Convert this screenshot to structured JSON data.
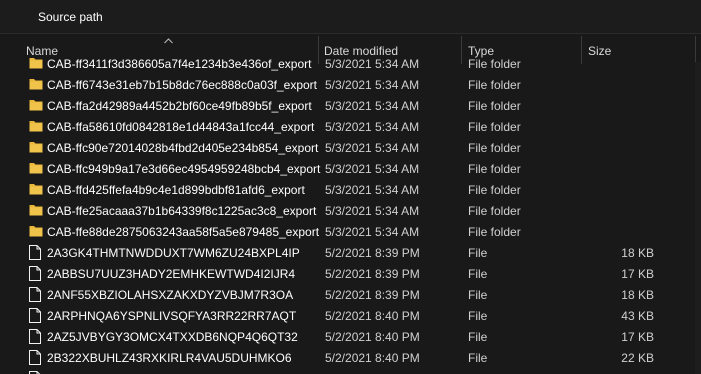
{
  "window": {
    "title": "Source path"
  },
  "columns": [
    {
      "key": "name",
      "label": "Name"
    },
    {
      "key": "date",
      "label": "Date modified"
    },
    {
      "key": "type",
      "label": "Type"
    },
    {
      "key": "size",
      "label": "Size"
    }
  ],
  "colors": {
    "folder": "#e8b73b",
    "file_icon": "#f2f2f2",
    "background": "#191919"
  },
  "rows": [
    {
      "name": "CAB-ff3411f3d386605a7f4e1234b3e436of_export",
      "date": "5/3/2021 5:34 AM",
      "type": "File folder",
      "size": "",
      "icon": "folder-icon"
    },
    {
      "name": "CAB-ff6743e31eb7b15b8dc76ec888c0a03f_export",
      "date": "5/3/2021 5:34 AM",
      "type": "File folder",
      "size": "",
      "icon": "folder-icon"
    },
    {
      "name": "CAB-ffa2d42989a4452b2bf60ce49fb89b5f_export",
      "date": "5/3/2021 5:34 AM",
      "type": "File folder",
      "size": "",
      "icon": "folder-icon"
    },
    {
      "name": "CAB-ffa58610fd0842818e1d44843a1fcc44_export",
      "date": "5/3/2021 5:34 AM",
      "type": "File folder",
      "size": "",
      "icon": "folder-icon"
    },
    {
      "name": "CAB-ffc90e72014028b4fbd2d405e234b854_export",
      "date": "5/3/2021 5:34 AM",
      "type": "File folder",
      "size": "",
      "icon": "folder-icon"
    },
    {
      "name": "CAB-ffc949b9a17e3d66ec4954959248bcb4_export",
      "date": "5/3/2021 5:34 AM",
      "type": "File folder",
      "size": "",
      "icon": "folder-icon"
    },
    {
      "name": "CAB-ffd425ffefa4b9c4e1d899bdbf81afd6_export",
      "date": "5/3/2021 5:34 AM",
      "type": "File folder",
      "size": "",
      "icon": "folder-icon"
    },
    {
      "name": "CAB-ffe25acaaa37b1b64339f8c1225ac3c8_export",
      "date": "5/3/2021 5:34 AM",
      "type": "File folder",
      "size": "",
      "icon": "folder-icon"
    },
    {
      "name": "CAB-ffe88de2875063243aa58f5a5e879485_export",
      "date": "5/3/2021 5:34 AM",
      "type": "File folder",
      "size": "",
      "icon": "folder-icon"
    },
    {
      "name": "2A3GK4THMTNWDDUXT7WM6ZU24BXPL4IP",
      "date": "5/2/2021 8:39 PM",
      "type": "File",
      "size": "18 KB",
      "icon": "file-icon"
    },
    {
      "name": "2ABBSU7UUZ3HADY2EMHKEWTWD4I2IJR4",
      "date": "5/2/2021 8:39 PM",
      "type": "File",
      "size": "17 KB",
      "icon": "file-icon"
    },
    {
      "name": "2ANF55XBZIOLAHSXZAKXDYZVBJM7R3OA",
      "date": "5/2/2021 8:39 PM",
      "type": "File",
      "size": "18 KB",
      "icon": "file-icon"
    },
    {
      "name": "2ARPHNQA6YSPNLIVSQFYA3RR22RR7AQT",
      "date": "5/2/2021 8:40 PM",
      "type": "File",
      "size": "43 KB",
      "icon": "file-icon"
    },
    {
      "name": "2AZ5JVBYGY3OMCX4TXXDB6NQP4Q6QT32",
      "date": "5/2/2021 8:40 PM",
      "type": "File",
      "size": "17 KB",
      "icon": "file-icon"
    },
    {
      "name": "2B322XBUHLZ43RXKIRLR4VAU5DUHMKO6",
      "date": "5/2/2021 8:40 PM",
      "type": "File",
      "size": "22 KB",
      "icon": "file-icon"
    },
    {
      "name": "",
      "date": "",
      "type": "",
      "size": "",
      "icon": "file-icon"
    }
  ]
}
